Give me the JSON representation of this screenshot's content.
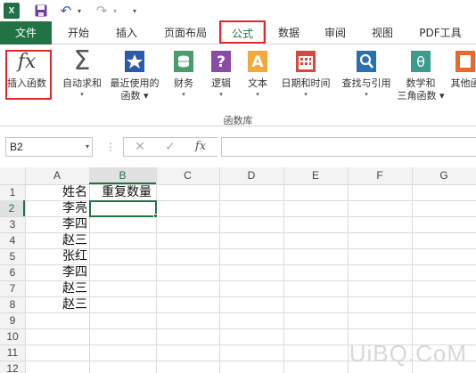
{
  "qat": {
    "app_logo": "X"
  },
  "tabs": [
    {
      "label": "文件"
    },
    {
      "label": "开始"
    },
    {
      "label": "插入"
    },
    {
      "label": "页面布局"
    },
    {
      "label": "公式"
    },
    {
      "label": "数据"
    },
    {
      "label": "审阅"
    },
    {
      "label": "视图"
    },
    {
      "label": "PDF工具"
    }
  ],
  "ribbon": {
    "buttons": [
      {
        "l1": "插入函数",
        "l2": "",
        "dd": ""
      },
      {
        "l1": "自动求和",
        "l2": "▾",
        "dd": ""
      },
      {
        "l1": "最近使用的",
        "l2": "函数 ▾",
        "dd": ""
      },
      {
        "l1": "财务",
        "l2": "▾",
        "dd": ""
      },
      {
        "l1": "逻辑",
        "l2": "▾",
        "dd": ""
      },
      {
        "l1": "文本",
        "l2": "▾",
        "dd": ""
      },
      {
        "l1": "日期和时间",
        "l2": "▾",
        "dd": ""
      },
      {
        "l1": "查找与引用",
        "l2": "▾",
        "dd": ""
      },
      {
        "l1": "数学和",
        "l2": "三角函数 ▾",
        "dd": ""
      },
      {
        "l1": "其他函",
        "l2": "",
        "dd": ""
      }
    ],
    "group_label": "函数库"
  },
  "formula_bar": {
    "name_box": "B2",
    "dots": "⋮",
    "cancel": "✕",
    "enter": "✓",
    "fx": "fx",
    "value": ""
  },
  "grid": {
    "columns": [
      "A",
      "B",
      "C",
      "D",
      "E",
      "F",
      "G"
    ],
    "rows": [
      "1",
      "2",
      "3",
      "4",
      "5",
      "6",
      "7",
      "8",
      "9",
      "10",
      "11",
      "12"
    ],
    "cells": {
      "A1": "姓名",
      "B1": "重复数量",
      "A2": "李亮",
      "A3": "李四",
      "A4": "赵三",
      "A5": "张红",
      "A6": "李四",
      "A7": "赵三",
      "A8": "赵三"
    },
    "selected": "B2"
  },
  "watermark": "UiBQ.CoM",
  "colors": {
    "accent": "#217346",
    "highlight": "#e2262a"
  }
}
